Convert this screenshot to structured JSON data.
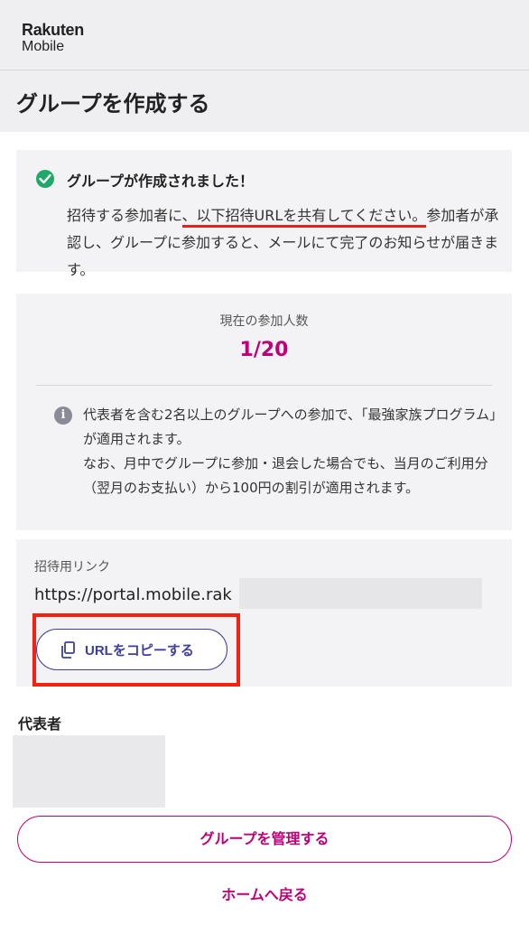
{
  "brand": {
    "line1": "Rakuten",
    "line2": "Mobile"
  },
  "page": {
    "title": "グループを作成する"
  },
  "success": {
    "title": "グループが作成されました！",
    "body_pre": "招待する参加者に",
    "body_highlight": "、以下招待URLを共有してください。",
    "body_post": "参加者が承認し、グループに参加すると、メールにて完了のお知らせが届きます。"
  },
  "members": {
    "label": "現在の参加人数",
    "count": "1/20",
    "note_line1": "代表者を含む2名以上のグループへの参加で、「最強家族プログラム」が適用されます。",
    "note_line2": "なお、月中でグループに参加・退会した場合でも、当月のご利用分（翌月のお支払い）から100円の割引が適用されます。"
  },
  "invite": {
    "label": "招待用リンク",
    "url": "https://portal.mobile.rak",
    "copy_label": "URLをコピーする"
  },
  "representative": {
    "label": "代表者"
  },
  "actions": {
    "manage_label": "グループを管理する",
    "home_label": "ホームへ戻る"
  },
  "colors": {
    "accent": "#bf0078",
    "copy_button": "#3d3f9c",
    "success": "#1fa866",
    "highlight": "#f5200f"
  }
}
